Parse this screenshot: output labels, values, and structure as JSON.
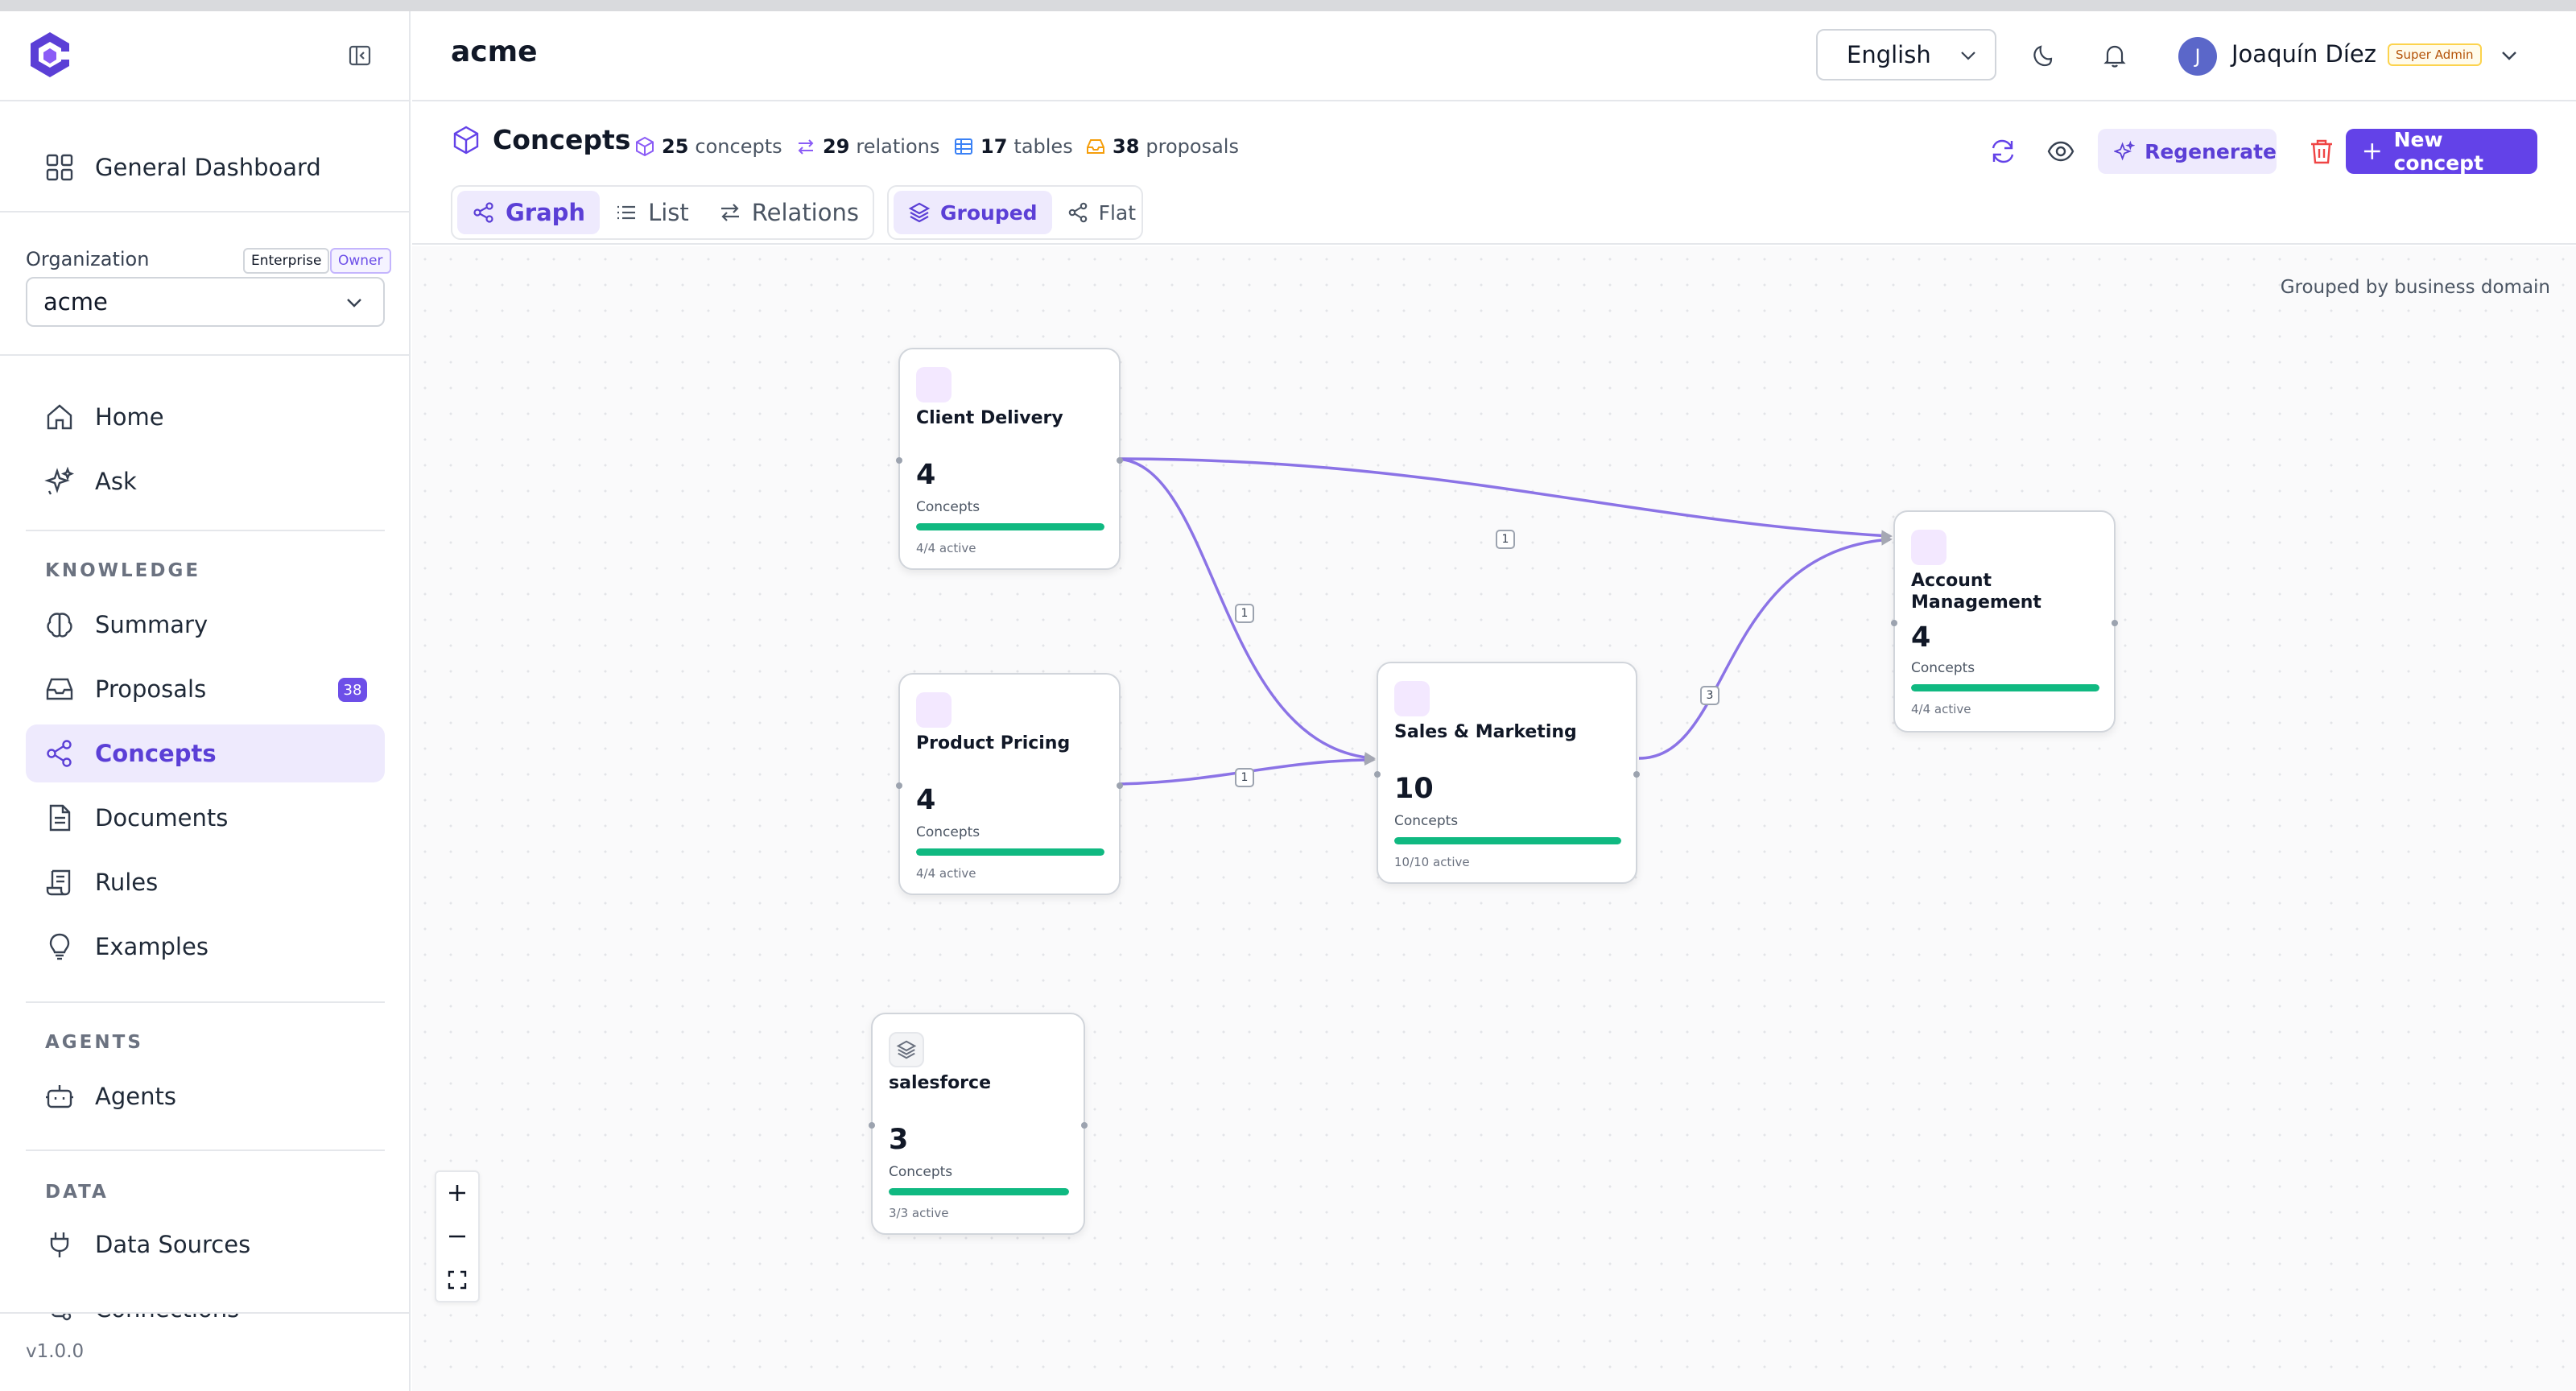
{
  "sidebar": {
    "dashboard_label": "General Dashboard",
    "organization": {
      "label": "Organization",
      "plan_badge": "Enterprise",
      "role_badge": "Owner",
      "selected": "acme"
    },
    "nav_primary": [
      {
        "label": "Home",
        "icon": "home-icon"
      },
      {
        "label": "Ask",
        "icon": "sparkles-icon"
      }
    ],
    "knowledge": {
      "section": "KNOWLEDGE",
      "items": [
        {
          "label": "Summary",
          "icon": "brain-icon"
        },
        {
          "label": "Proposals",
          "icon": "inbox-icon",
          "badge": "38"
        },
        {
          "label": "Concepts",
          "icon": "share-icon",
          "active": true
        },
        {
          "label": "Documents",
          "icon": "document-icon"
        },
        {
          "label": "Rules",
          "icon": "scroll-icon"
        },
        {
          "label": "Examples",
          "icon": "lightbulb-icon"
        }
      ]
    },
    "agents": {
      "section": "AGENTS",
      "items": [
        {
          "label": "Agents",
          "icon": "bot-icon"
        }
      ]
    },
    "data": {
      "section": "DATA",
      "items": [
        {
          "label": "Data Sources",
          "icon": "plug-icon"
        },
        {
          "label": "Connections",
          "icon": "connection-icon"
        }
      ]
    },
    "version": "v1.0.0"
  },
  "header": {
    "org_title": "acme",
    "language": "English",
    "user": {
      "initial": "J",
      "name": "Joaquín Díez",
      "role_badge": "Super Admin"
    }
  },
  "toolbar": {
    "title": "Concepts",
    "stats": {
      "concepts_count": "25",
      "concepts_label": "concepts",
      "relations_count": "29",
      "relations_label": "relations",
      "tables_count": "17",
      "tables_label": "tables",
      "proposals_count": "38",
      "proposals_label": "proposals"
    },
    "views": {
      "graph": "Graph",
      "list": "List",
      "relations": "Relations"
    },
    "modes": {
      "grouped": "Grouped",
      "flat": "Flat"
    },
    "regenerate_label": "Regenerate",
    "new_concept_label": "New concept"
  },
  "canvas": {
    "note": "Grouped by business domain",
    "nodes": [
      {
        "name": "Client Delivery",
        "count": "4",
        "count_label": "Concepts",
        "active": "4/4 active",
        "progress": 1.0
      },
      {
        "name": "Product Pricing",
        "count": "4",
        "count_label": "Concepts",
        "active": "4/4 active",
        "progress": 1.0
      },
      {
        "name": "Sales & Marketing",
        "count": "10",
        "count_label": "Concepts",
        "active": "10/10 active",
        "progress": 1.0
      },
      {
        "name": "Account Management",
        "count": "4",
        "count_label": "Concepts",
        "active": "4/4 active",
        "progress": 1.0
      },
      {
        "name": "salesforce",
        "count": "3",
        "count_label": "Concepts",
        "active": "3/3 active",
        "progress": 1.0
      }
    ],
    "edges": [
      {
        "from": "Client Delivery",
        "to": "Account Management",
        "label": "1"
      },
      {
        "from": "Client Delivery",
        "to": "Sales & Marketing",
        "label": "1"
      },
      {
        "from": "Product Pricing",
        "to": "Sales & Marketing",
        "label": "1"
      },
      {
        "from": "Sales & Marketing",
        "to": "Account Management",
        "label": "3"
      }
    ],
    "colors": {
      "accent": "#6342e8",
      "edge": "#8b73e6",
      "progress": "#10b981"
    }
  }
}
